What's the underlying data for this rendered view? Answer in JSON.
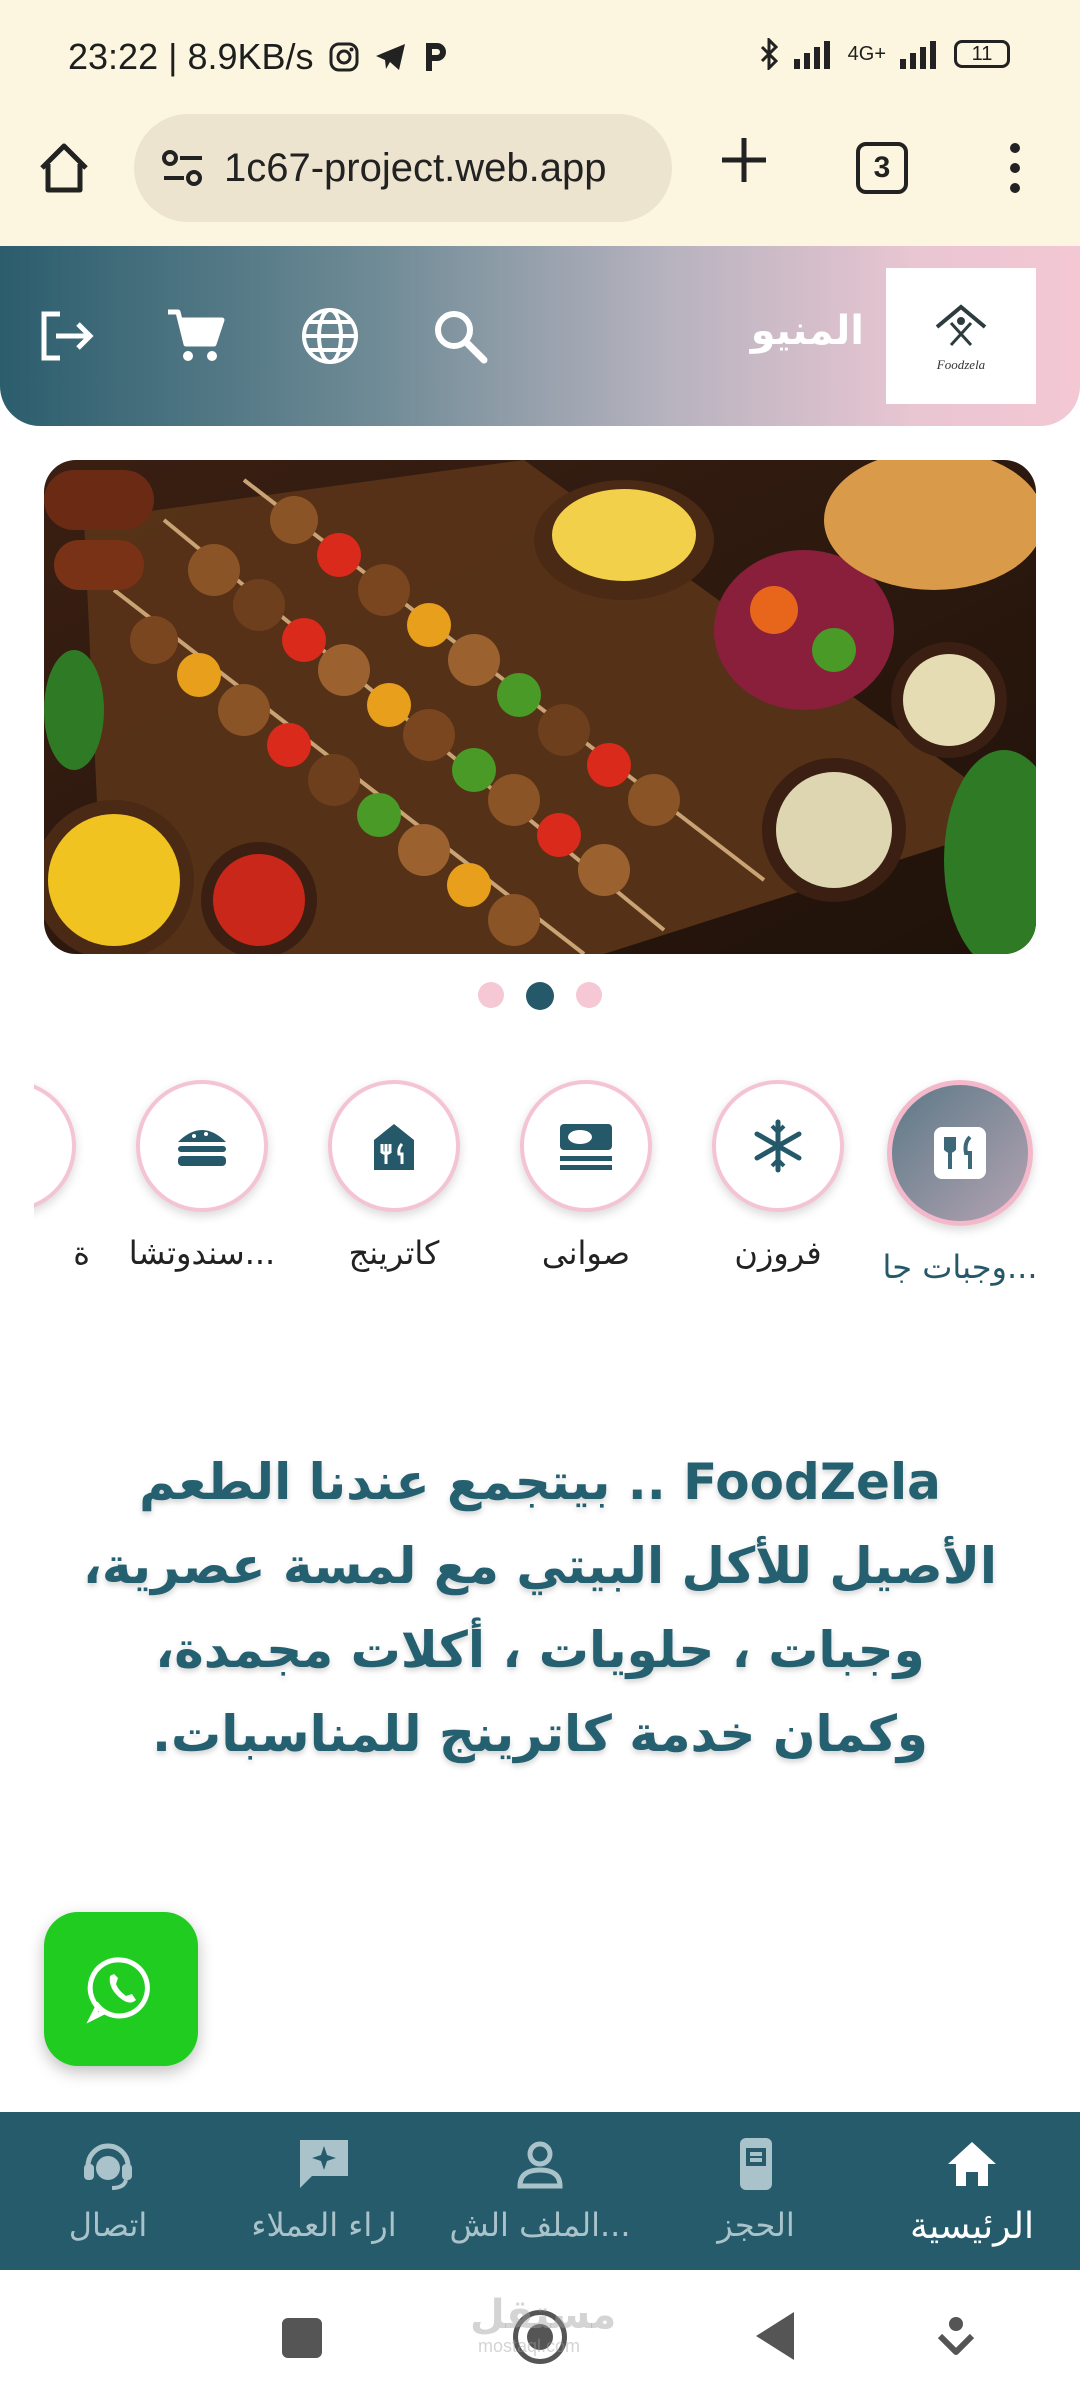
{
  "status_bar": {
    "time_speed": "23:22 | 8.9KB/s",
    "network": "4G+",
    "battery": "11"
  },
  "browser": {
    "url": "1c67-project.web.app",
    "tab_count": "3"
  },
  "header": {
    "menu_title": "المنيو",
    "logo_text": "Foodzela"
  },
  "carousel": {
    "slide_count": 3,
    "active_index": 1
  },
  "categories": [
    {
      "label": "وجبات جا...",
      "icon": "utensils-icon",
      "active": true
    },
    {
      "label": "فروزن",
      "icon": "snowflake-icon",
      "active": false
    },
    {
      "label": "صوانى",
      "icon": "tray-icon",
      "active": false
    },
    {
      "label": "كاترينج",
      "icon": "catering-icon",
      "active": false
    },
    {
      "label": "سندوتشا...",
      "icon": "burger-icon",
      "active": false
    },
    {
      "label": "ة",
      "icon": "partial-icon",
      "active": false
    }
  ],
  "tagline": "FoodZela .. بيتجمع عندنا الطعم الأصيل للأكل البيتي مع لمسة عصرية، وجبات ، حلويات ، أكلات مجمدة، وكمان خدمة كاترينج للمناسبات.",
  "bottom_nav": [
    {
      "label": "الرئيسية",
      "icon": "home-icon",
      "active": true
    },
    {
      "label": "الحجز",
      "icon": "booking-icon",
      "active": false
    },
    {
      "label": "الملف الش...",
      "icon": "profile-icon",
      "active": false
    },
    {
      "label": "اراء العملاء",
      "icon": "reviews-icon",
      "active": false
    },
    {
      "label": "اتصال",
      "icon": "support-icon",
      "active": false
    }
  ],
  "watermark": {
    "arabic": "مستقل",
    "latin": "mostaql.com"
  }
}
